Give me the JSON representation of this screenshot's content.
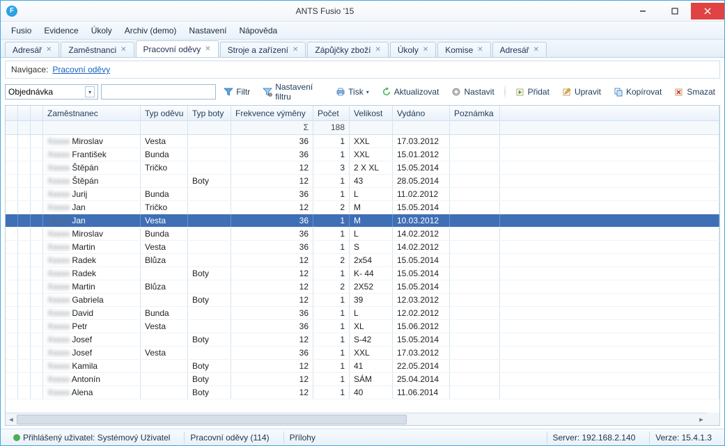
{
  "window": {
    "title": "ANTS Fusio '15"
  },
  "menu": [
    "Fusio",
    "Evidence",
    "Úkoly",
    "Archiv (demo)",
    "Nastavení",
    "Nápověda"
  ],
  "tabs": [
    {
      "label": "Adresář",
      "active": false
    },
    {
      "label": "Zaměstnanci",
      "active": false
    },
    {
      "label": "Pracovní oděvy",
      "active": true
    },
    {
      "label": "Stroje a zařízení",
      "active": false
    },
    {
      "label": "Zápůjčky zboží",
      "active": false
    },
    {
      "label": "Úkoly",
      "active": false
    },
    {
      "label": "Komise",
      "active": false
    },
    {
      "label": "Adresář",
      "active": false
    }
  ],
  "nav": {
    "label": "Navigace:",
    "link": "Pracovní oděvy"
  },
  "toolbar": {
    "combo": "Objednávka",
    "filter": "Filtr",
    "filter_settings": "Nastavení filtru",
    "print": "Tisk",
    "refresh": "Aktualizovat",
    "settings": "Nastavit",
    "add": "Přidat",
    "edit": "Upravit",
    "copy": "Kopírovat",
    "delete": "Smazat"
  },
  "columns": [
    "",
    "",
    "",
    "Zaměstnanec",
    "Typ oděvu",
    "Typ boty",
    "Frekvence výměny",
    "Počet",
    "Velikost",
    "Vydáno",
    "Poznámka",
    ""
  ],
  "sum": {
    "sigma": "Σ",
    "total": "188"
  },
  "rows": [
    {
      "emp": "Miroslav",
      "typ": "Vesta",
      "boty": "",
      "freq": "36",
      "pocet": "1",
      "vel": "XXL",
      "vyd": "17.03.2012",
      "sel": false
    },
    {
      "emp": "František",
      "typ": "Bunda",
      "boty": "",
      "freq": "36",
      "pocet": "1",
      "vel": "XXL",
      "vyd": "15.01.2012",
      "sel": false
    },
    {
      "emp": "Štěpán",
      "typ": "Tričko",
      "boty": "",
      "freq": "12",
      "pocet": "3",
      "vel": "2 X XL",
      "vyd": "15.05.2014",
      "sel": false
    },
    {
      "emp": "Štěpán",
      "typ": "",
      "boty": "Boty",
      "freq": "12",
      "pocet": "1",
      "vel": "43",
      "vyd": "28.05.2014",
      "sel": false
    },
    {
      "emp": "Jurij",
      "typ": "Bunda",
      "boty": "",
      "freq": "36",
      "pocet": "1",
      "vel": "L",
      "vyd": "11.02.2012",
      "sel": false
    },
    {
      "emp": "Jan",
      "typ": "Tričko",
      "boty": "",
      "freq": "12",
      "pocet": "2",
      "vel": "M",
      "vyd": "15.05.2014",
      "sel": false
    },
    {
      "emp": "Jan",
      "typ": "Vesta",
      "boty": "",
      "freq": "36",
      "pocet": "1",
      "vel": "M",
      "vyd": "10.03.2012",
      "sel": true
    },
    {
      "emp": "Miroslav",
      "typ": "Bunda",
      "boty": "",
      "freq": "36",
      "pocet": "1",
      "vel": "L",
      "vyd": "14.02.2012",
      "sel": false
    },
    {
      "emp": "Martin",
      "typ": "Vesta",
      "boty": "",
      "freq": "36",
      "pocet": "1",
      "vel": "S",
      "vyd": "14.02.2012",
      "sel": false
    },
    {
      "emp": "Radek",
      "typ": "Blůza",
      "boty": "",
      "freq": "12",
      "pocet": "2",
      "vel": "2x54",
      "vyd": "15.05.2014",
      "sel": false
    },
    {
      "emp": "Radek",
      "typ": "",
      "boty": "Boty",
      "freq": "12",
      "pocet": "1",
      "vel": "K- 44",
      "vyd": "15.05.2014",
      "sel": false
    },
    {
      "emp": "Martin",
      "typ": "Blůza",
      "boty": "",
      "freq": "12",
      "pocet": "2",
      "vel": "2X52",
      "vyd": "15.05.2014",
      "sel": false
    },
    {
      "emp": "Gabriela",
      "typ": "",
      "boty": "Boty",
      "freq": "12",
      "pocet": "1",
      "vel": "39",
      "vyd": "12.03.2012",
      "sel": false
    },
    {
      "emp": "David",
      "typ": "Bunda",
      "boty": "",
      "freq": "36",
      "pocet": "1",
      "vel": "L",
      "vyd": "12.02.2012",
      "sel": false
    },
    {
      "emp": "Petr",
      "typ": "Vesta",
      "boty": "",
      "freq": "36",
      "pocet": "1",
      "vel": "XL",
      "vyd": "15.06.2012",
      "sel": false
    },
    {
      "emp": "Josef",
      "typ": "",
      "boty": "Boty",
      "freq": "12",
      "pocet": "1",
      "vel": "S-42",
      "vyd": "15.05.2014",
      "sel": false
    },
    {
      "emp": "Josef",
      "typ": "Vesta",
      "boty": "",
      "freq": "36",
      "pocet": "1",
      "vel": "XXL",
      "vyd": "17.03.2012",
      "sel": false
    },
    {
      "emp": "Kamila",
      "typ": "",
      "boty": "Boty",
      "freq": "12",
      "pocet": "1",
      "vel": "41",
      "vyd": "22.05.2014",
      "sel": false
    },
    {
      "emp": "Antonín",
      "typ": "",
      "boty": "Boty",
      "freq": "12",
      "pocet": "1",
      "vel": "SÁM",
      "vyd": "25.04.2014",
      "sel": false
    },
    {
      "emp": "Alena",
      "typ": "",
      "boty": "Boty",
      "freq": "12",
      "pocet": "1",
      "vel": "40",
      "vyd": "11.06.2014",
      "sel": false
    }
  ],
  "status": {
    "user_label": "Přihlášený uživatel: Systémový Uživatel",
    "page": "Pracovní oděvy (114)",
    "attachments": "Přílohy",
    "server": "Server: 192.168.2.140",
    "version": "Verze: 15.4.1.3"
  }
}
